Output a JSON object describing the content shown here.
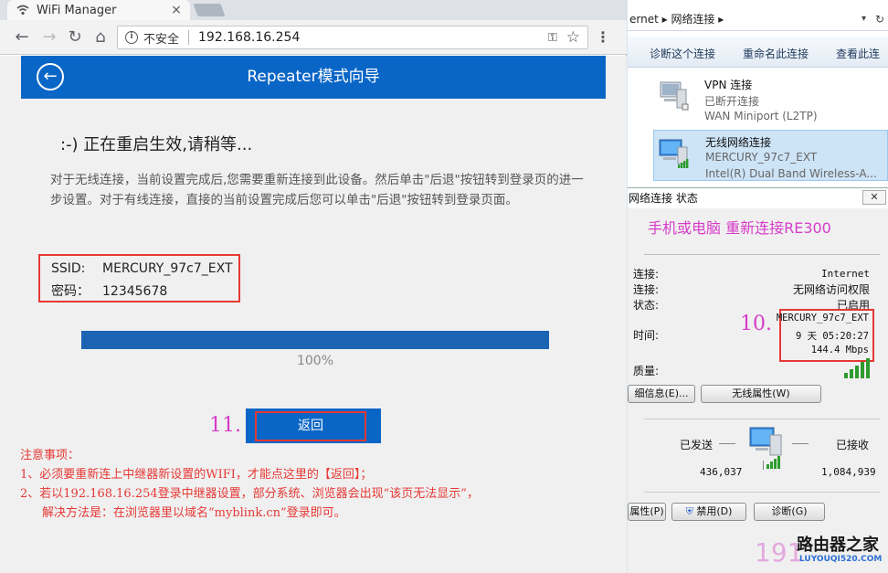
{
  "browser": {
    "tab_title": "WiFi Manager",
    "tab_close": "×",
    "insecure_label": "不安全",
    "url": "192.168.16.254"
  },
  "page": {
    "header_title": "Repeater模式向导",
    "status": ":-) 正在重启生效,请稍等...",
    "paragraph": "对于无线连接，当前设置完成后,您需要重新连接到此设备。然后单击\"后退\"按钮转到登录页的进一步设置。对于有线连接，直接的当前设置完成后您可以单击\"后退\"按钮转到登录页面。",
    "ssid_label": "SSID:",
    "ssid_value": "MERCURY_97c7_EXT",
    "password_label": "密码：",
    "password_value": "12345678",
    "progress": 1.0,
    "progress_text": "100%",
    "step_label": "11.",
    "return_button": "返回"
  },
  "notes": {
    "title": "注意事项：",
    "line1": "1、必须要重新连上中继器新设置的WIFI，才能点这里的【返回】；",
    "line2": "2、若以192.168.16.254登录中继器设置，部分系统、浏览器会出现“该页无法显示”，",
    "line3": "解决方法是：在浏览器里以域名“myblink.cn”登录即可。"
  },
  "explorer": {
    "address": "ernet ▸ 网络连接 ▸",
    "dropdown": "▾",
    "refresh": "↻",
    "cmd_diagnose": "诊断这个连接",
    "cmd_rename": "重命名此连接",
    "cmd_view": "查看此连",
    "connections": [
      {
        "name": "VPN 连接",
        "status": "已断开连接",
        "device": "WAN Miniport (L2TP)"
      },
      {
        "name": "无线网络连接",
        "status": "MERCURY_97c7_EXT",
        "device": "Intel(R) Dual Band Wireless-A..."
      }
    ]
  },
  "dialog": {
    "title": "网络连接 状态",
    "close": "✕",
    "caption": "手机或电脑  重新连接RE300",
    "labels": {
      "ipv4": "连接:",
      "ipv6": "连接:",
      "media": "状态:",
      "duration": "时间:",
      "quality": "质量:"
    },
    "values": {
      "ipv4": "Internet",
      "ipv6": "无网络访问权限",
      "media": "已启用",
      "ssid": "MERCURY_97c7_EXT",
      "duration": "9 天 05:20:27",
      "speed": "144.4 Mbps"
    },
    "step_label": "10.",
    "btn_details": "细信息(E)...",
    "btn_wireless_props": "无线属性(W)",
    "activity_sent": "已发送",
    "activity_received": "已接收",
    "sent_value": "436,037",
    "received_value": "1,084,939",
    "btn_properties": "属性(P)",
    "btn_disable": "禁用(D)",
    "btn_diagnose": "诊断(G)"
  },
  "watermark": {
    "number": "191",
    "logo": "路由器之家",
    "url": "LUYOUQI520.COM"
  }
}
